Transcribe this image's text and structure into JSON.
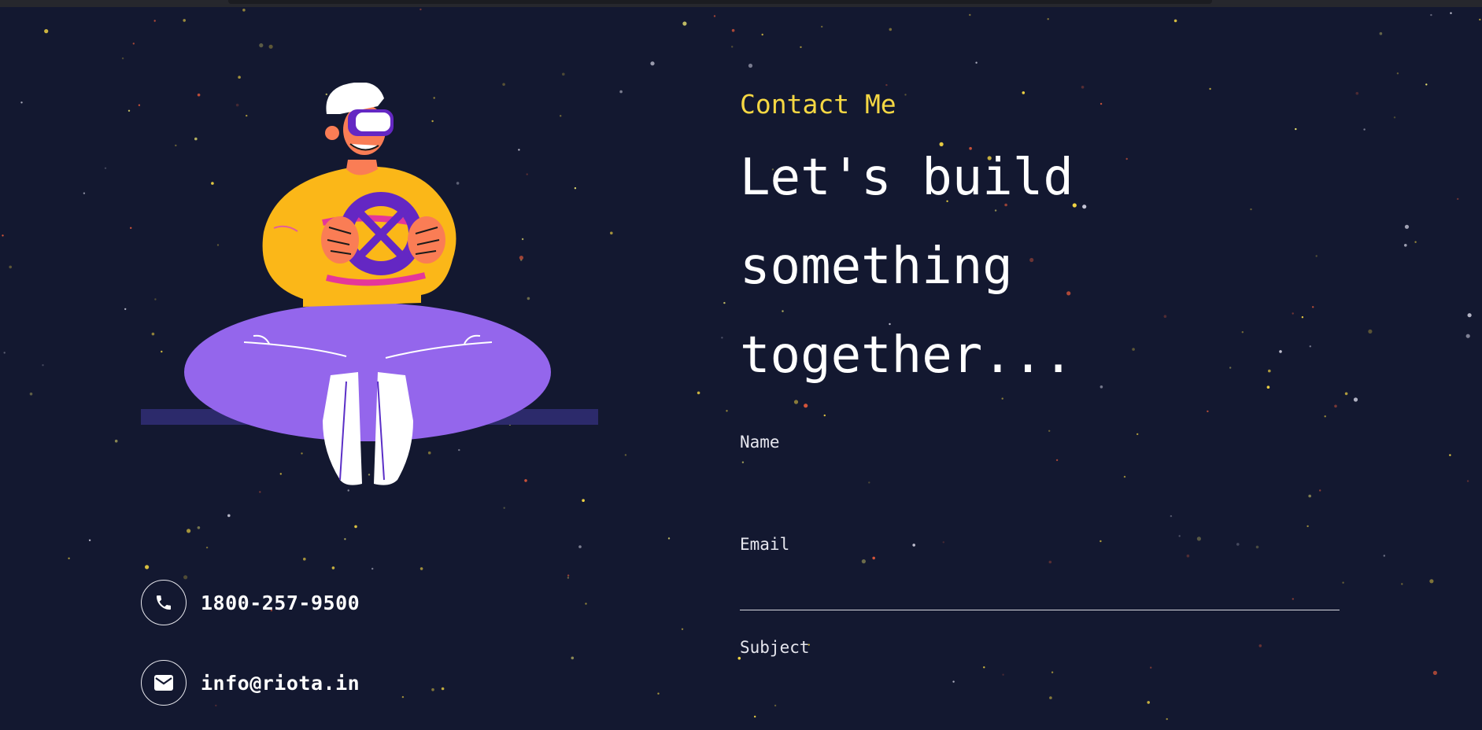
{
  "contact": {
    "phone": "1800-257-9500",
    "email": "info@riota.in",
    "icons": {
      "phone": "phone-icon",
      "email": "mail-icon"
    }
  },
  "hero": {
    "eyebrow": "Contact Me",
    "headline": "Let's build something together..."
  },
  "form": {
    "name_label": "Name",
    "email_label": "Email",
    "subject_label": "Subject",
    "name_value": "",
    "email_value": "",
    "subject_value": ""
  },
  "colors": {
    "background": "#131830",
    "accent": "#f5d743",
    "text": "#ffffff"
  }
}
